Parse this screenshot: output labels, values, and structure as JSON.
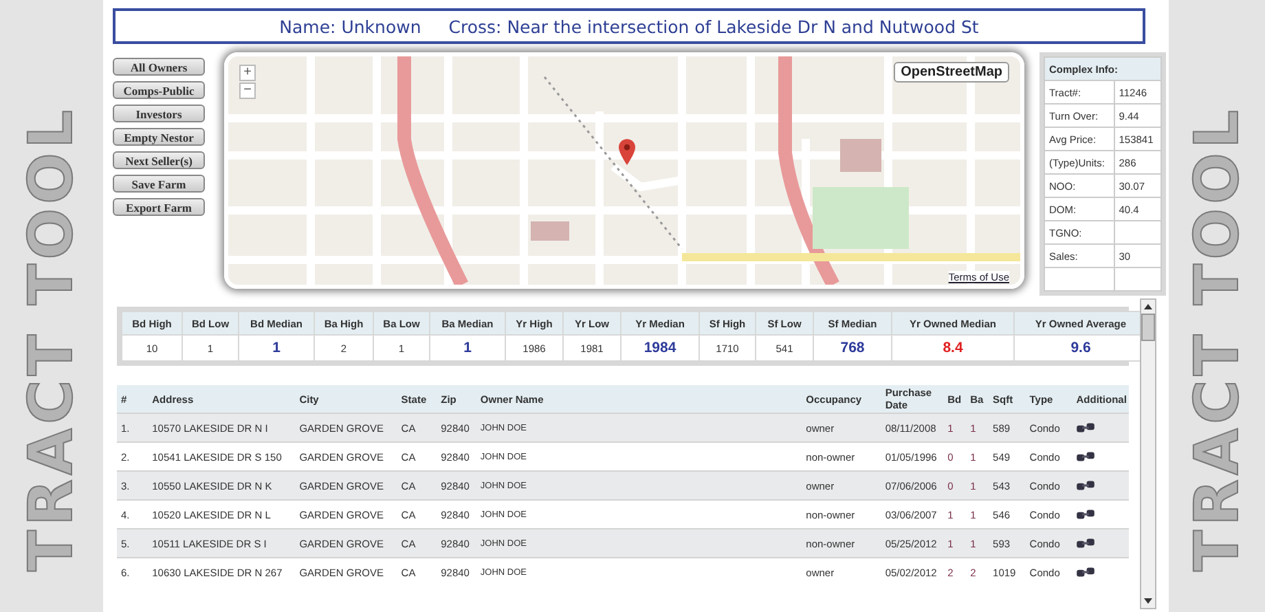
{
  "side_text": [
    "TRACT TOOL",
    "TRACT TOOL"
  ],
  "header": {
    "name": "Name: Unknown",
    "cross": "Cross: Near the intersection of Lakeside Dr N and Nutwood St"
  },
  "buttons": [
    "All Owners",
    "Comps-Public",
    "Investors",
    "Empty Nestor",
    "Next Seller(s)",
    "Save Farm",
    "Export Farm"
  ],
  "map": {
    "kind": "picture",
    "zoom_in": "+",
    "zoom_out": "−",
    "layer_button": "OpenStreetMap",
    "terms": "Terms of Use"
  },
  "complex_info": {
    "title": "Complex Info:",
    "rows": [
      {
        "label": "Tract#:",
        "value": "11246"
      },
      {
        "label": "Turn Over:",
        "value": "9.44"
      },
      {
        "label": "Avg Price:",
        "value": "153841"
      },
      {
        "label": "(Type)Units:",
        "value": "286"
      },
      {
        "label": "NOO:",
        "value": "30.07"
      },
      {
        "label": "DOM:",
        "value": "40.4"
      },
      {
        "label": "TGNO:"
      },
      {
        "label": "Sales:",
        "value": "30"
      }
    ]
  },
  "stats": [
    {
      "label": "Bd High",
      "value": "10",
      "kind": "plain"
    },
    {
      "label": "Bd Low",
      "value": "1",
      "kind": "plain"
    },
    {
      "label": "Bd Median",
      "value": "1",
      "kind": "median"
    },
    {
      "label": "Ba High",
      "value": "2",
      "kind": "plain"
    },
    {
      "label": "Ba Low",
      "value": "1",
      "kind": "plain"
    },
    {
      "label": "Ba Median",
      "value": "1",
      "kind": "median"
    },
    {
      "label": "Yr High",
      "value": "1986",
      "kind": "plain"
    },
    {
      "label": "Yr Low",
      "value": "1981",
      "kind": "plain"
    },
    {
      "label": "Yr Median",
      "value": "1984",
      "kind": "median"
    },
    {
      "label": "Sf High",
      "value": "1710",
      "kind": "plain"
    },
    {
      "label": "Sf Low",
      "value": "541",
      "kind": "plain"
    },
    {
      "label": "Sf Median",
      "value": "768",
      "kind": "median"
    },
    {
      "label": "Yr Owned Median",
      "value": "8.4",
      "kind": "alert"
    },
    {
      "label": "Yr Owned Average",
      "value": "9.6",
      "kind": "median"
    }
  ],
  "listing": {
    "columns": [
      "#",
      "Address",
      "City",
      "State",
      "Zip",
      "Owner Name",
      "Occupancy",
      "Purchase Date",
      "Bd",
      "Ba",
      "Sqft",
      "Type",
      "Additional"
    ],
    "rows": [
      {
        "cells": [
          "1.",
          "10570 LAKESIDE DR N I",
          "GARDEN GROVE",
          "CA",
          "92840",
          "JOHN DOE",
          "owner",
          "08/11/2008",
          "1",
          "1",
          "589",
          "Condo"
        ]
      },
      {
        "cells": [
          "2.",
          "10541 LAKESIDE DR S 150",
          "GARDEN GROVE",
          "CA",
          "92840",
          "JOHN DOE",
          "non-owner",
          "01/05/1996",
          "0",
          "1",
          "549",
          "Condo"
        ]
      },
      {
        "cells": [
          "3.",
          "10550 LAKESIDE DR N K",
          "GARDEN GROVE",
          "CA",
          "92840",
          "JOHN DOE",
          "owner",
          "07/06/2006",
          "0",
          "1",
          "543",
          "Condo"
        ]
      },
      {
        "cells": [
          "4.",
          "10520 LAKESIDE DR N L",
          "GARDEN GROVE",
          "CA",
          "92840",
          "JOHN DOE",
          "non-owner",
          "03/06/2007",
          "1",
          "1",
          "546",
          "Condo"
        ]
      },
      {
        "cells": [
          "5.",
          "10511 LAKESIDE DR S I",
          "GARDEN GROVE",
          "CA",
          "92840",
          "JOHN DOE",
          "non-owner",
          "05/25/2012",
          "1",
          "1",
          "593",
          "Condo"
        ]
      },
      {
        "cells": [
          "6.",
          "10630 LAKESIDE DR N 267",
          "GARDEN GROVE",
          "CA",
          "92840",
          "JOHN DOE",
          "owner",
          "05/02/2012",
          "2",
          "2",
          "1019",
          "Condo"
        ]
      }
    ]
  }
}
